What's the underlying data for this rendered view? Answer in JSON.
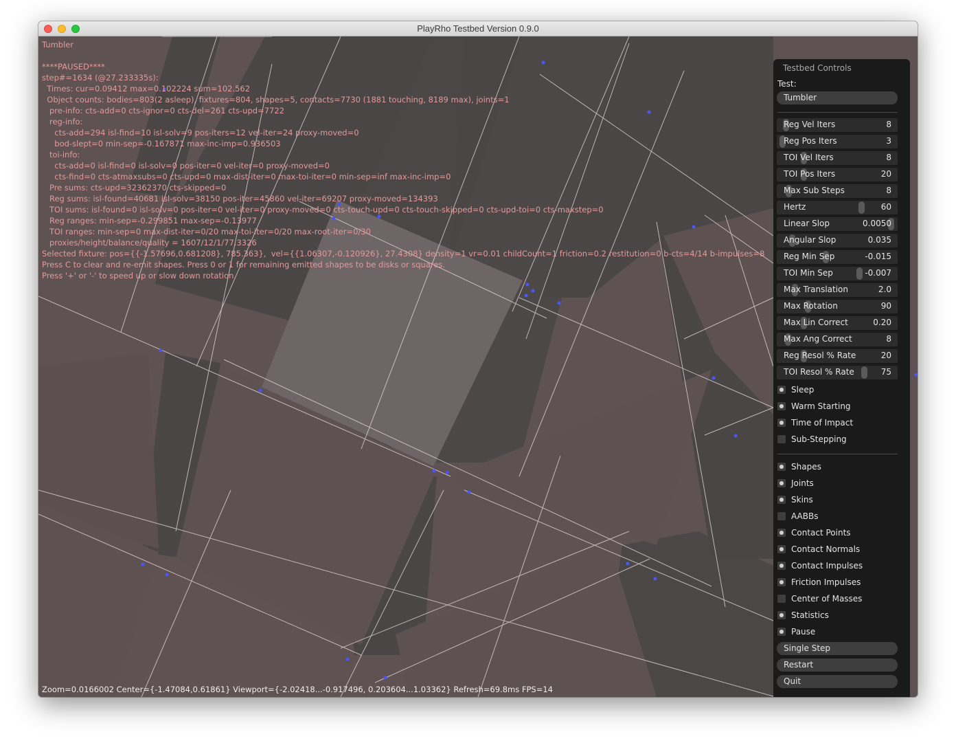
{
  "window": {
    "title": "PlayRho Testbed Version 0.9.0"
  },
  "overlay": {
    "test_name": "Tumbler",
    "lines": [
      "****PAUSED****",
      "step#=1634 (@27.233335s):",
      "  Times: cur=0.09412 max=0.102224 sum=102.562",
      "  Object counts: bodies=803(2 asleep), fixtures=804, shapes=5, contacts=7730 (1881 touching, 8189 max), joints=1",
      "   pre-info: cts-add=0 cts-ignor=0 cts-del=261 cts-upd=7722",
      "   reg-info:",
      "     cts-add=294 isl-find=10 isl-solv=9 pos-iters=12 vel-iter=24 proxy-moved=0",
      "     bod-slept=0 min-sep=-0.167871 max-inc-imp=0.936503",
      "   toi-info:",
      "     cts-add=0 isl-find=0 isl-solv=0 pos-iter=0 vel-iter=0 proxy-moved=0",
      "     cts-find=0 cts-atmaxsubs=0 cts-upd=0 max-dist-iter=0 max-toi-iter=0 min-sep=inf max-inc-imp=0",
      "   Pre sums: cts-upd=32362370 cts-skipped=0",
      "   Reg sums: isl-found=40681 isl-solv=38150 pos-iter=45860 vel-iter=69207 proxy-moved=134393",
      "   TOI sums: isl-found=0 isl-solv=0 pos-iter=0 vel-iter=0 proxy-moved=0 cts-touch-upd=0 cts-touch-skipped=0 cts-upd-toi=0 cts-maxstep=0",
      "   Reg ranges: min-sep=-0.299851 max-sep=-0.13977",
      "   TOI ranges: min-sep=0 max-dist-iter=0/20 max-toi-iter=0/20 max-root-iter=0/30",
      "   proxies/height/balance/quality = 1607/12/1/77.3326",
      "Selected fixture: pos={{-1.57696,0.681208}, 785.363},  vel={{1.06307,-0.120926}, 27.4308} density=1 vr=0.01 childCount=1 friction=0.2 restitution=0 b-cts=4/14 b-impulses=8",
      "Press C to clear and re-emit shapes. Press 0 or 1 for remaining emitted shapes to be disks or squares.",
      "Press '+' or '-' to speed up or slow down rotation."
    ],
    "status": "Zoom=0.0166002 Center={-1.47084,0.61861} Viewport={-2.02418...-0.917496, 0.203604...1.03362} Refresh=69.8ms FPS=14"
  },
  "panel": {
    "title": "Testbed Controls",
    "test_label": "Test:",
    "test_value": "Tumbler",
    "sliders": [
      {
        "label": "Reg Vel Iters",
        "value": "8",
        "fill": 0.04
      },
      {
        "label": "Reg Pos Iters",
        "value": "3",
        "fill": 0.01
      },
      {
        "label": "TOI Vel Iters",
        "value": "8",
        "fill": 0.2
      },
      {
        "label": "TOI Pos Iters",
        "value": "20",
        "fill": 0.2
      },
      {
        "label": "Max Sub Steps",
        "value": "8",
        "fill": 0.07
      },
      {
        "label": "Hertz",
        "value": "60",
        "fill": 0.72
      },
      {
        "label": "Linear Slop",
        "value": "0.0050",
        "fill": 0.98
      },
      {
        "label": "Angular Slop",
        "value": "0.035",
        "fill": 0.1
      },
      {
        "label": "Reg Min Sep",
        "value": "-0.015",
        "fill": 0.4
      },
      {
        "label": "TOI Min Sep",
        "value": "-0.007",
        "fill": 0.7
      },
      {
        "label": "Max Translation",
        "value": "2.0",
        "fill": 0.12
      },
      {
        "label": "Max Rotation",
        "value": "90",
        "fill": 0.24
      },
      {
        "label": "Max Lin Correct",
        "value": "0.20",
        "fill": 0.2
      },
      {
        "label": "Max Ang Correct",
        "value": "8",
        "fill": 0.06
      },
      {
        "label": "Reg Resol % Rate",
        "value": "20",
        "fill": 0.2
      },
      {
        "label": "TOI Resol % Rate",
        "value": "75",
        "fill": 0.74
      }
    ],
    "physics_checks": [
      {
        "label": "Sleep",
        "checked": true
      },
      {
        "label": "Warm Starting",
        "checked": true
      },
      {
        "label": "Time of Impact",
        "checked": true
      },
      {
        "label": "Sub-Stepping",
        "checked": false
      }
    ],
    "draw_checks": [
      {
        "label": "Shapes",
        "checked": true
      },
      {
        "label": "Joints",
        "checked": true
      },
      {
        "label": "Skins",
        "checked": true
      },
      {
        "label": "AABBs",
        "checked": false
      },
      {
        "label": "Contact Points",
        "checked": true
      },
      {
        "label": "Contact Normals",
        "checked": true
      },
      {
        "label": "Contact Impulses",
        "checked": true
      },
      {
        "label": "Friction Impulses",
        "checked": true
      },
      {
        "label": "Center of Masses",
        "checked": false
      },
      {
        "label": "Statistics",
        "checked": true
      },
      {
        "label": "Pause",
        "checked": true
      }
    ],
    "buttons": {
      "single_step": "Single Step",
      "restart": "Restart",
      "quit": "Quit"
    }
  },
  "colors": {
    "background": "#5e5252",
    "wall": "#4a4646",
    "selected": "#6e6666",
    "text": "#e39a9a",
    "contact": "#4a55ff"
  }
}
